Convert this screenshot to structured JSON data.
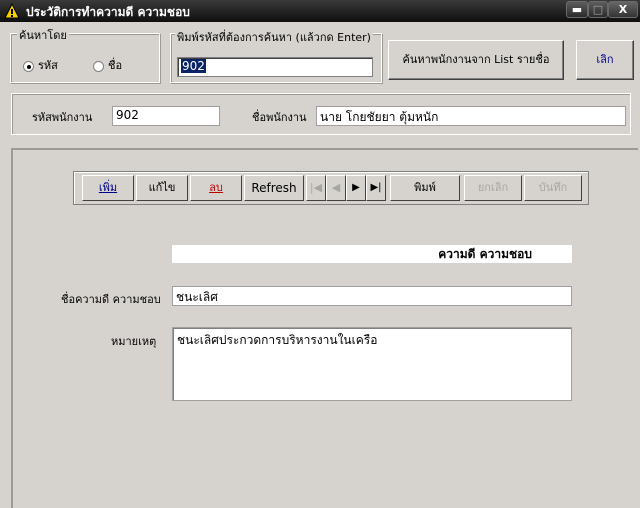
{
  "window": {
    "title": "ประวัติการทำความดี ความชอบ",
    "min_label": "▬",
    "max_label": "□",
    "close_label": "X"
  },
  "search_by": {
    "legend": "ค้นหาโดย",
    "options": [
      {
        "label": "รหัส",
        "selected": true
      },
      {
        "label": "ชื่อ",
        "selected": false
      }
    ]
  },
  "enter_code": {
    "legend": "พิมพ์รหัสที่ต้องการค้นหา (แล้วกด Enter)",
    "value": "902"
  },
  "buttons": {
    "search_list": "ค้นหาพนักงานจาก List รายชื่อ",
    "cancel": "เลิก"
  },
  "employee": {
    "code_label": "รหัสพนักงาน",
    "code_value": "902",
    "name_label": "ชื่อพนักงาน",
    "name_value": "นาย โกยชัยยา ตุ้มหนัก"
  },
  "toolbar": {
    "add": "เพิ่ม",
    "edit": "แก้ไข",
    "delete": "ลบ",
    "refresh": "Refresh",
    "first": "|◀",
    "prev": "◀",
    "next": "▶",
    "last": "▶|",
    "print": "พิมพ์",
    "undo": "ยกเลิก",
    "save": "บันทึก"
  },
  "section": {
    "header": "ความดี ความชอบ",
    "fav_label": "ชื่อความดี ความชอบ",
    "fav_value": "ชนะเลิศ",
    "note_label": "หมายเหตุ",
    "note_value": "ชนะเลิศประกวดการบริหารงานในเครือ"
  }
}
